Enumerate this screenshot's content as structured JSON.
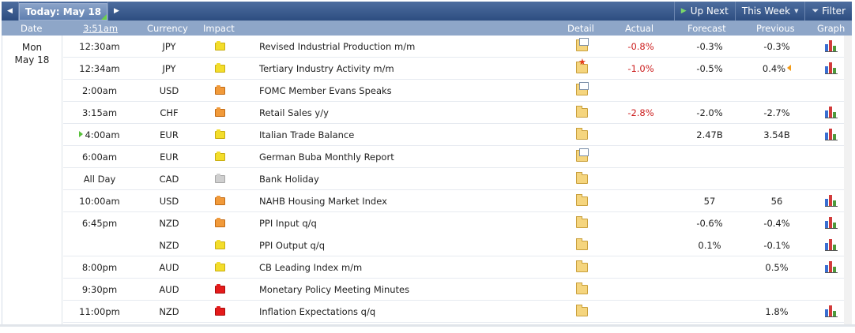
{
  "toolbar": {
    "prev_icon": "left-arrow-icon",
    "today_label": "Today: May 18",
    "next_icon": "right-arrow-icon",
    "up_next_label": "Up Next",
    "this_week_label": "This Week",
    "filter_label": "Filter"
  },
  "header": {
    "date": "Date",
    "time": "3:51am",
    "currency": "Currency",
    "impact": "Impact",
    "detail": "Detail",
    "actual": "Actual",
    "forecast": "Forecast",
    "previous": "Previous",
    "graph": "Graph"
  },
  "date_block": {
    "day": "Mon",
    "date": "May 18"
  },
  "impact_colors": {
    "low": "#f3dd2b",
    "medium": "#f19a3a",
    "high": "#e41b1b",
    "none": "#cfcfcf"
  },
  "rows": [
    {
      "time": "12:30am",
      "currency": "JPY",
      "impact": "low",
      "event": "Revised Industrial Production m/m",
      "detail_icon": "folder-doc-icon",
      "actual": "-0.8%",
      "forecast": "-0.3%",
      "previous": "-0.3%",
      "graph": true
    },
    {
      "time": "12:34am",
      "currency": "JPY",
      "impact": "low",
      "event": "Tertiary Industry Activity m/m",
      "detail_icon": "folder-star-icon",
      "actual": "-1.0%",
      "forecast": "-0.5%",
      "previous": "0.4%",
      "revised": true,
      "graph": true
    },
    {
      "time": "2:00am",
      "currency": "USD",
      "impact": "medium",
      "event": "FOMC Member Evans Speaks",
      "detail_icon": "folder-doc-icon",
      "actual": "",
      "forecast": "",
      "previous": "",
      "graph": false
    },
    {
      "time": "3:15am",
      "currency": "CHF",
      "impact": "medium",
      "event": "Retail Sales y/y",
      "detail_icon": "folder-icon",
      "actual": "-2.8%",
      "forecast": "-2.0%",
      "previous": "-2.7%",
      "graph": true
    },
    {
      "time": "4:00am",
      "currency": "EUR",
      "impact": "low",
      "event": "Italian Trade Balance",
      "detail_icon": "folder-icon",
      "actual": "",
      "forecast": "2.47B",
      "previous": "3.54B",
      "graph": true,
      "live": true
    },
    {
      "time": "6:00am",
      "currency": "EUR",
      "impact": "low",
      "event": "German Buba Monthly Report",
      "detail_icon": "folder-doc-icon",
      "actual": "",
      "forecast": "",
      "previous": "",
      "graph": false
    },
    {
      "time": "All Day",
      "currency": "CAD",
      "impact": "none",
      "event": "Bank Holiday",
      "detail_icon": "folder-icon",
      "actual": "",
      "forecast": "",
      "previous": "",
      "graph": false
    },
    {
      "time": "10:00am",
      "currency": "USD",
      "impact": "medium",
      "event": "NAHB Housing Market Index",
      "detail_icon": "folder-icon",
      "actual": "",
      "forecast": "57",
      "previous": "56",
      "graph": true
    },
    {
      "time": "6:45pm",
      "currency": "NZD",
      "impact": "medium",
      "event": "PPI Input q/q",
      "detail_icon": "folder-icon",
      "actual": "",
      "forecast": "-0.6%",
      "previous": "-0.4%",
      "graph": true
    },
    {
      "time": "",
      "currency": "NZD",
      "impact": "low",
      "event": "PPI Output q/q",
      "detail_icon": "folder-icon",
      "actual": "",
      "forecast": "0.1%",
      "previous": "-0.1%",
      "graph": true
    },
    {
      "time": "8:00pm",
      "currency": "AUD",
      "impact": "low",
      "event": "CB Leading Index m/m",
      "detail_icon": "folder-icon",
      "actual": "",
      "forecast": "",
      "previous": "0.5%",
      "graph": true
    },
    {
      "time": "9:30pm",
      "currency": "AUD",
      "impact": "high",
      "event": "Monetary Policy Meeting Minutes",
      "detail_icon": "folder-icon",
      "actual": "",
      "forecast": "",
      "previous": "",
      "graph": false
    },
    {
      "time": "11:00pm",
      "currency": "NZD",
      "impact": "high",
      "event": "Inflation Expectations q/q",
      "detail_icon": "folder-icon",
      "actual": "",
      "forecast": "",
      "previous": "1.8%",
      "graph": true
    }
  ]
}
